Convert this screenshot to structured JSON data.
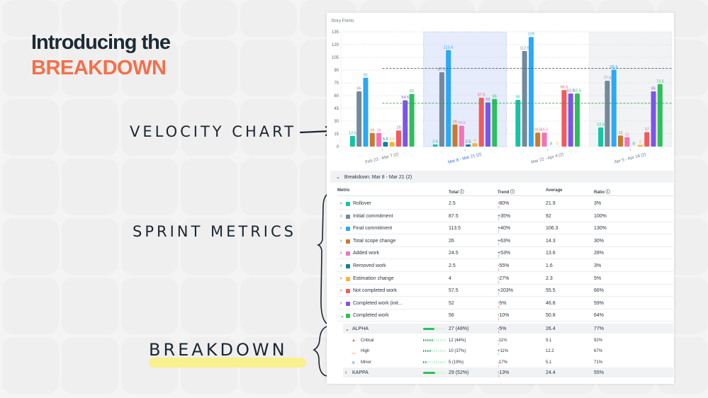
{
  "slide": {
    "title_line1": "Introducing the",
    "title_line2": "BREAKDOWN",
    "annotations": {
      "velocity": "VELOCITY CHART",
      "sprint": "SPRINT METRICS",
      "breakdown": "BREAKDOWN"
    },
    "colors": {
      "title": "#1c2b36",
      "accent": "#f5704a",
      "highlight": "#f9f08e"
    }
  },
  "chart_data": {
    "type": "bar",
    "ylabel": "Story Points",
    "ylim": [
      0,
      135
    ],
    "yticks": [
      0,
      15,
      30,
      45,
      60,
      75,
      90,
      105,
      120,
      135
    ],
    "grid": true,
    "categories": [
      "Feb 23 - Mar 7 (2)",
      "Mar 8 - Mar 21 (2)",
      "Mar 22 - Apr 4 (2)",
      "Apr 5 - Apr 18 (2)"
    ],
    "selected_category": "Mar 8 - Mar 21 (2)",
    "series": [
      {
        "name": "Rollover",
        "color": "#14c4a4",
        "values": [
          12.5,
          2.5,
          55,
          22.5
        ]
      },
      {
        "name": "Initial commitment",
        "color": "#74899a",
        "values": [
          65,
          87.5,
          112.5,
          77.5
        ]
      },
      {
        "name": "Final commitment",
        "color": "#2aa9f5",
        "values": [
          81,
          113.5,
          129,
          90.5
        ]
      },
      {
        "name": "Total scope change",
        "color": "#c97a2e",
        "values": [
          16,
          26,
          16.5,
          13
        ]
      },
      {
        "name": "Added work",
        "color": "#f472b6",
        "values": [
          16,
          24.5,
          16.5,
          11
        ]
      },
      {
        "name": "Removed work",
        "color": "#0e7f9e",
        "values": [
          5.5,
          2.5,
          0,
          0
        ]
      },
      {
        "name": "Estimation change",
        "color": "#fbb13c",
        "values": [
          5.5,
          4,
          0,
          2
        ]
      },
      {
        "name": "Not completed work",
        "color": "#f4595b",
        "values": [
          19,
          57.5,
          66.5,
          17
        ]
      },
      {
        "name": "Completed work (initial)",
        "color": "#7c55e8",
        "values": [
          54.5,
          52,
          62.5,
          65
        ]
      },
      {
        "name": "Completed work",
        "color": "#2cbf5d",
        "values": [
          62,
          56,
          62.5,
          73.5
        ]
      }
    ],
    "reference_lines": [
      {
        "value": 92,
        "color": "#4a5866"
      },
      {
        "value": 51,
        "color": "#2e9e4f"
      }
    ]
  },
  "breakdown": {
    "header": "Breakdown: Mar 8 - Mar 21 (2)",
    "columns": {
      "metric": "Metric",
      "total": "Total",
      "trend": "Trend",
      "average": "Average",
      "ratio": "Ratio"
    },
    "rows": [
      {
        "label": "Rollover",
        "color": "#14c4a4",
        "total": "2.5",
        "dir": "down",
        "trend": "-80%",
        "average": "21.9",
        "ratio": "3%"
      },
      {
        "label": "Initial commitment",
        "color": "#74899a",
        "total": "87.5",
        "dir": "up",
        "trend": "+35%",
        "average": "92",
        "ratio": "100%"
      },
      {
        "label": "Final commitment",
        "color": "#2aa9f5",
        "total": "113.5",
        "dir": "up",
        "trend": "+40%",
        "average": "106.3",
        "ratio": "130%"
      },
      {
        "label": "Total scope change",
        "color": "#c97a2e",
        "total": "26",
        "dir": "up",
        "trend": "+63%",
        "average": "14.3",
        "ratio": "30%"
      },
      {
        "label": "Added work",
        "color": "#f472b6",
        "total": "24.5",
        "dir": "up",
        "trend": "+53%",
        "average": "13.6",
        "ratio": "28%"
      },
      {
        "label": "Removed work",
        "color": "#0e7f9e",
        "total": "2.5",
        "dir": "down",
        "trend": "-55%",
        "average": "1.6",
        "ratio": "3%"
      },
      {
        "label": "Estimation change",
        "color": "#fbb13c",
        "total": "4",
        "dir": "down",
        "trend": "-27%",
        "average": "2.3",
        "ratio": "5%"
      },
      {
        "label": "Not completed work",
        "color": "#f4595b",
        "total": "57.5",
        "dir": "up",
        "trend": "+203%",
        "average": "55.5",
        "ratio": "66%"
      },
      {
        "label": "Completed work (init...",
        "color": "#7c55e8",
        "total": "52",
        "dir": "down",
        "trend": "-5%",
        "average": "46.8",
        "ratio": "59%"
      },
      {
        "label": "Completed work",
        "color": "#2cbf5d",
        "total": "56",
        "dir": "down",
        "trend": "-10%",
        "average": "50.8",
        "ratio": "64%",
        "expanded": true
      }
    ],
    "groups": [
      {
        "label": "ALPHA",
        "share": 48,
        "total": "27 (48%)",
        "dir": "down",
        "trend": "-5%",
        "average": "26.4",
        "ratio": "77%",
        "expanded": true,
        "items": [
          {
            "label": "Critical",
            "icon": "priority-critical-icon",
            "share": 44,
            "total": "12 (44%)",
            "dir": "down",
            "trend": "-11%",
            "average": "9.1",
            "ratio": "92%"
          },
          {
            "label": "High",
            "icon": "priority-high-icon",
            "share": 37,
            "total": "10 (37%)",
            "dir": "up",
            "trend": "+11%",
            "average": "12.2",
            "ratio": "67%"
          },
          {
            "label": "Minor",
            "icon": "priority-minor-icon",
            "share": 19,
            "total": "5 (19%)",
            "dir": "down",
            "trend": "-17%",
            "average": "5.1",
            "ratio": "71%"
          }
        ]
      },
      {
        "label": "KAPPA",
        "share": 52,
        "total": "29 (52%)",
        "dir": "down",
        "trend": "-13%",
        "average": "24.4",
        "ratio": "55%",
        "expanded": false
      }
    ]
  }
}
